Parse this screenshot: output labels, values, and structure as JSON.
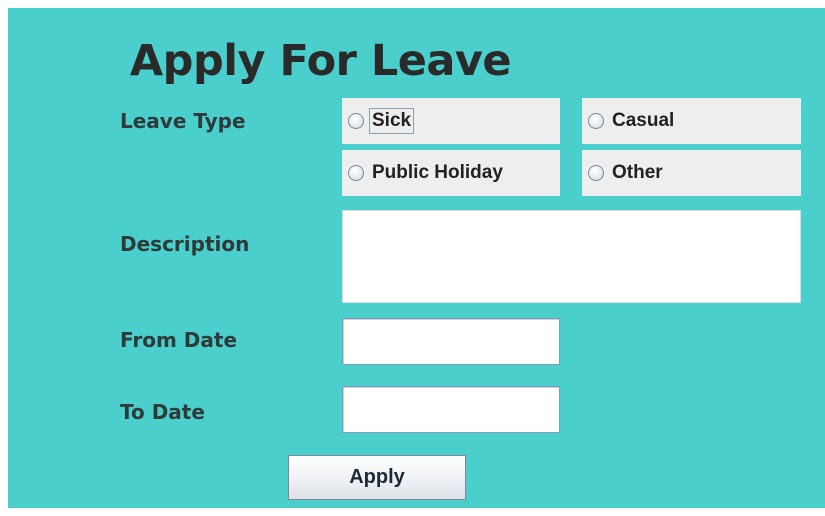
{
  "title": "Apply For Leave",
  "labels": {
    "leave_type": "Leave Type",
    "description": "Description",
    "from_date": "From Date",
    "to_date": "To Date"
  },
  "leave_types": [
    {
      "label": "Sick",
      "selected": false,
      "focused": true
    },
    {
      "label": "Casual",
      "selected": false
    },
    {
      "label": "Public Holiday",
      "selected": false
    },
    {
      "label": "Other",
      "selected": false
    }
  ],
  "description": {
    "value": ""
  },
  "from_date": {
    "value": ""
  },
  "to_date": {
    "value": ""
  },
  "apply_button": {
    "label": "Apply"
  },
  "colors": {
    "panel_background": "#4acfcc",
    "radio_background": "#eeeeee"
  }
}
